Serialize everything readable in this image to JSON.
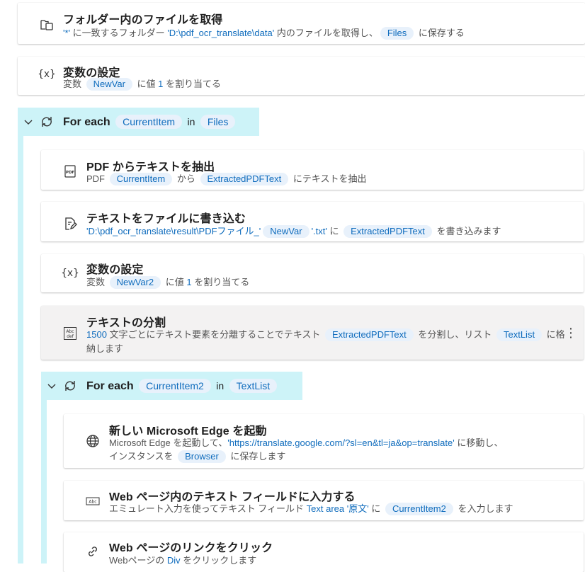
{
  "actions": {
    "get_files": {
      "title": "フォルダー内のファイルを取得",
      "filter": "'*'",
      "text1": " に一致するフォルダー ",
      "folder": "'D:\\pdf_ocr_translate\\data'",
      "text2": " 内のファイルを取得し、",
      "var": "Files",
      "text3": " に保存する"
    },
    "set_var1": {
      "title": "変数の設定",
      "text1": "変数 ",
      "var": "NewVar",
      "text2": " に値 ",
      "value": "1",
      "text3": " を割り当てる"
    },
    "foreach1": {
      "label": "For each",
      "item_var": "CurrentItem",
      "in": "in",
      "list_var": "Files"
    },
    "pdf_extract": {
      "title": "PDF からテキストを抽出",
      "text1": "PDF ",
      "var1": "CurrentItem",
      "text2": " から ",
      "var2": "ExtractedPDFText",
      "text3": " にテキストを抽出"
    },
    "write_file": {
      "title": "テキストをファイルに書き込む",
      "path": "'D:\\pdf_ocr_translate\\result\\PDFファイル_'",
      "var1": "NewVar",
      "ext": "'.txt'",
      "text1": " に ",
      "var2": "ExtractedPDFText",
      "text2": " を書き込みます"
    },
    "set_var2": {
      "title": "変数の設定",
      "text1": "変数 ",
      "var": "NewVar2",
      "text2": " に値 ",
      "value": "1",
      "text3": " を割り当てる"
    },
    "split_text": {
      "title": "テキストの分割",
      "count": "1500",
      "text1": " 文字ごとにテキスト要素を分離することでテキスト ",
      "var1": "ExtractedPDFText",
      "text2": " を分割し、リスト ",
      "var2": "TextList",
      "text3": " に格",
      "text4": "納します",
      "more": "⋮"
    },
    "foreach2": {
      "label": "For each",
      "item_var": "CurrentItem2",
      "in": "in",
      "list_var": "TextList"
    },
    "launch_edge": {
      "title": "新しい Microsoft Edge を起動",
      "text1": "Microsoft Edge を起動して、",
      "url": "'https://translate.google.com/?sl=en&tl=ja&op=translate'",
      "text2": " に移動し、",
      "text3": "インスタンスを ",
      "var": "Browser",
      "text4": " に保存します"
    },
    "fill_field": {
      "title": "Web ページ内のテキスト フィールドに入力する",
      "text1": "エミュレート入力を使ってテキスト フィールド ",
      "field": "Text area '原文'",
      "text2": " に ",
      "var": "CurrentItem2",
      "text3": " を入力します"
    },
    "click_link": {
      "title": "Web ページのリンクをクリック",
      "text1": "Webページの ",
      "element": "Div",
      "text2": " をクリックします"
    }
  }
}
